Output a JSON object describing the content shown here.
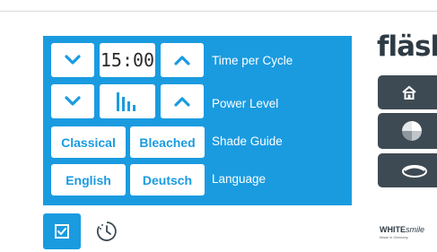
{
  "panel": {
    "time_value": "15:00",
    "time_label": "Time per Cycle",
    "power_label": "Power Level",
    "shade_option_1": "Classical",
    "shade_option_2": "Bleached",
    "shade_label": "Shade Guide",
    "lang_option_1": "English",
    "lang_option_2": "Deutsch",
    "lang_label": "Language"
  },
  "brand": {
    "title": "fläsh.",
    "name_bold": "WHITE",
    "name_italic": "smile",
    "sub": "Made in Germany"
  },
  "colors": {
    "accent": "#1a9be0",
    "dark": "#3d4a53"
  },
  "icons": [
    "chevron-down-icon",
    "chevron-up-icon",
    "power-bars-icon",
    "home-icon",
    "shade-pie-icon",
    "tray-icon",
    "checkbox-icon",
    "clock-icon"
  ]
}
